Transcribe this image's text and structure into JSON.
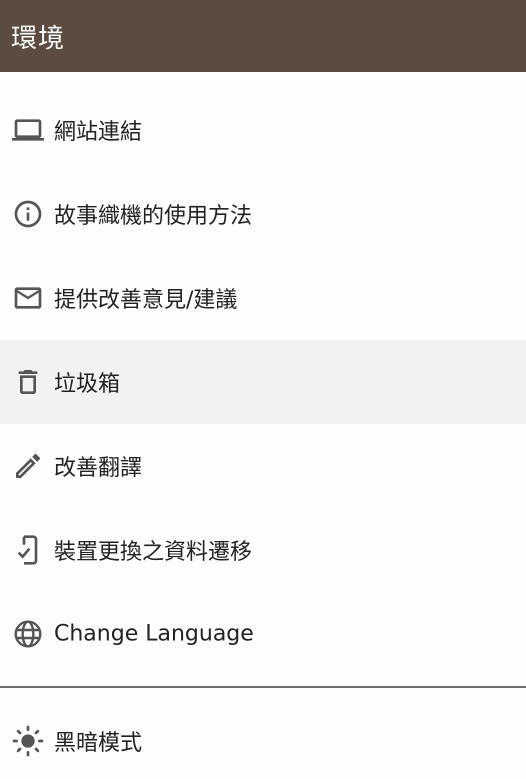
{
  "header": {
    "title": "環境",
    "bg_color": "#5b4b40"
  },
  "menu": {
    "items": [
      {
        "label": "網站連結",
        "icon": "laptop-icon"
      },
      {
        "label": "故事織機的使用方法",
        "icon": "info-icon"
      },
      {
        "label": "提供改善意見/建議",
        "icon": "mail-icon"
      },
      {
        "label": "垃圾箱",
        "icon": "trash-icon",
        "selected": true
      },
      {
        "label": "改善翻譯",
        "icon": "pencil-icon"
      },
      {
        "label": "裝置更換之資料遷移",
        "icon": "device-check-icon"
      },
      {
        "label": "Change Language",
        "icon": "globe-icon"
      }
    ],
    "bottom_item": {
      "label": "黑暗模式",
      "icon": "sun-icon"
    }
  }
}
